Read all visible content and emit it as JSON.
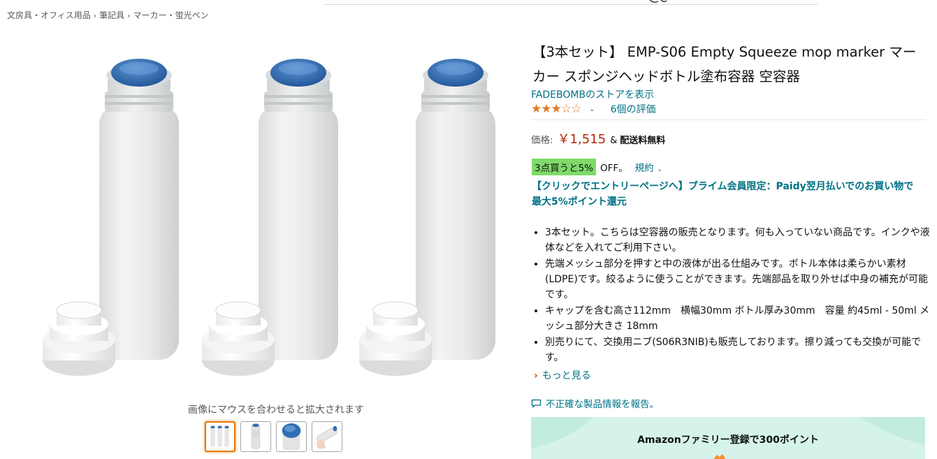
{
  "breadcrumb": [
    "文房具・オフィス用品",
    "筆記具",
    "マーカー・蛍光ペン"
  ],
  "breadcrumb_sep": "›",
  "gallery": {
    "zoom_hint": "画像にマウスを合わせると拡大されます",
    "thumbnail_count": 4,
    "selected_index": 0
  },
  "product": {
    "title": "【3本セット】 EMP-S06 Empty Squeeze mop marker マーカー スポンジヘッドボトル塗布容器 空容器",
    "store_link": "FADEBOMBのストアを表示",
    "rating_stars": 3,
    "rating_stars_max": 5,
    "rating_count": "6個の評価",
    "price_label": "価格:",
    "price": "￥1,515",
    "amp": "&",
    "shipping": "配送料無料",
    "promo_badge": "3点買うと5%",
    "promo_off": "OFF。",
    "promo_terms": "規約",
    "paidy_link": "【クリックでエントリーページへ】プライム会員限定：Paidy翌月払いでのお買い物で最大5%ポイント還元",
    "bullets": [
      "3本セット。こちらは空容器の販売となります。何も入っていない商品です。インクや液体などを入れてご利用下さい。",
      "先端メッシュ部分を押すと中の液体が出る仕組みです。ボトル本体は柔らかい素材(LDPE)です。絞るように使うことができます。先端部品を取り外せば中身の補充が可能です。",
      "キャップを含む高さ112mm　横幅30mm ボトル厚み30mm　容量 約45ml - 50ml メッシュ部分大きさ 18mm",
      "別売りにて、交換用ニブ(S06R3NIB)も販売しております。擦り減っても交換が可能です。"
    ],
    "see_more": "もっと見る",
    "report_link": "不正確な製品情報を報告。"
  },
  "banner": {
    "text": "Amazonファミリー登録で300ポイント"
  },
  "colors": {
    "link": "#007185",
    "price": "#b12704",
    "star": "#de7921",
    "promo_green": "#7fda69",
    "sponge_blue": "#2f6fb5",
    "thumb_selected": "#e77600"
  }
}
